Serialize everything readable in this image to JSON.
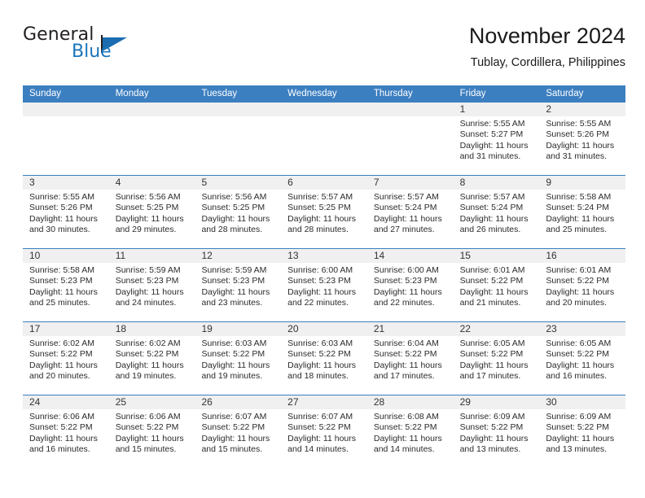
{
  "brand": {
    "name_top": "General",
    "name_bottom": "Blue",
    "flag_icon": "triangle-flag-icon",
    "accent_color": "#1b75bb"
  },
  "header": {
    "title": "November 2024",
    "location": "Tublay, Cordillera, Philippines"
  },
  "calendar": {
    "header_color": "#3c7fc0",
    "daynum_band_color": "#f0f0f0",
    "weekdays": [
      "Sunday",
      "Monday",
      "Tuesday",
      "Wednesday",
      "Thursday",
      "Friday",
      "Saturday"
    ],
    "weeks": [
      [
        {
          "day": "",
          "empty": true
        },
        {
          "day": "",
          "empty": true
        },
        {
          "day": "",
          "empty": true
        },
        {
          "day": "",
          "empty": true
        },
        {
          "day": "",
          "empty": true
        },
        {
          "day": "1",
          "sunrise": "Sunrise: 5:55 AM",
          "sunset": "Sunset: 5:27 PM",
          "daylight1": "Daylight: 11 hours",
          "daylight2": "and 31 minutes."
        },
        {
          "day": "2",
          "sunrise": "Sunrise: 5:55 AM",
          "sunset": "Sunset: 5:26 PM",
          "daylight1": "Daylight: 11 hours",
          "daylight2": "and 31 minutes."
        }
      ],
      [
        {
          "day": "3",
          "sunrise": "Sunrise: 5:55 AM",
          "sunset": "Sunset: 5:26 PM",
          "daylight1": "Daylight: 11 hours",
          "daylight2": "and 30 minutes."
        },
        {
          "day": "4",
          "sunrise": "Sunrise: 5:56 AM",
          "sunset": "Sunset: 5:25 PM",
          "daylight1": "Daylight: 11 hours",
          "daylight2": "and 29 minutes."
        },
        {
          "day": "5",
          "sunrise": "Sunrise: 5:56 AM",
          "sunset": "Sunset: 5:25 PM",
          "daylight1": "Daylight: 11 hours",
          "daylight2": "and 28 minutes."
        },
        {
          "day": "6",
          "sunrise": "Sunrise: 5:57 AM",
          "sunset": "Sunset: 5:25 PM",
          "daylight1": "Daylight: 11 hours",
          "daylight2": "and 28 minutes."
        },
        {
          "day": "7",
          "sunrise": "Sunrise: 5:57 AM",
          "sunset": "Sunset: 5:24 PM",
          "daylight1": "Daylight: 11 hours",
          "daylight2": "and 27 minutes."
        },
        {
          "day": "8",
          "sunrise": "Sunrise: 5:57 AM",
          "sunset": "Sunset: 5:24 PM",
          "daylight1": "Daylight: 11 hours",
          "daylight2": "and 26 minutes."
        },
        {
          "day": "9",
          "sunrise": "Sunrise: 5:58 AM",
          "sunset": "Sunset: 5:24 PM",
          "daylight1": "Daylight: 11 hours",
          "daylight2": "and 25 minutes."
        }
      ],
      [
        {
          "day": "10",
          "sunrise": "Sunrise: 5:58 AM",
          "sunset": "Sunset: 5:23 PM",
          "daylight1": "Daylight: 11 hours",
          "daylight2": "and 25 minutes."
        },
        {
          "day": "11",
          "sunrise": "Sunrise: 5:59 AM",
          "sunset": "Sunset: 5:23 PM",
          "daylight1": "Daylight: 11 hours",
          "daylight2": "and 24 minutes."
        },
        {
          "day": "12",
          "sunrise": "Sunrise: 5:59 AM",
          "sunset": "Sunset: 5:23 PM",
          "daylight1": "Daylight: 11 hours",
          "daylight2": "and 23 minutes."
        },
        {
          "day": "13",
          "sunrise": "Sunrise: 6:00 AM",
          "sunset": "Sunset: 5:23 PM",
          "daylight1": "Daylight: 11 hours",
          "daylight2": "and 22 minutes."
        },
        {
          "day": "14",
          "sunrise": "Sunrise: 6:00 AM",
          "sunset": "Sunset: 5:23 PM",
          "daylight1": "Daylight: 11 hours",
          "daylight2": "and 22 minutes."
        },
        {
          "day": "15",
          "sunrise": "Sunrise: 6:01 AM",
          "sunset": "Sunset: 5:22 PM",
          "daylight1": "Daylight: 11 hours",
          "daylight2": "and 21 minutes."
        },
        {
          "day": "16",
          "sunrise": "Sunrise: 6:01 AM",
          "sunset": "Sunset: 5:22 PM",
          "daylight1": "Daylight: 11 hours",
          "daylight2": "and 20 minutes."
        }
      ],
      [
        {
          "day": "17",
          "sunrise": "Sunrise: 6:02 AM",
          "sunset": "Sunset: 5:22 PM",
          "daylight1": "Daylight: 11 hours",
          "daylight2": "and 20 minutes."
        },
        {
          "day": "18",
          "sunrise": "Sunrise: 6:02 AM",
          "sunset": "Sunset: 5:22 PM",
          "daylight1": "Daylight: 11 hours",
          "daylight2": "and 19 minutes."
        },
        {
          "day": "19",
          "sunrise": "Sunrise: 6:03 AM",
          "sunset": "Sunset: 5:22 PM",
          "daylight1": "Daylight: 11 hours",
          "daylight2": "and 19 minutes."
        },
        {
          "day": "20",
          "sunrise": "Sunrise: 6:03 AM",
          "sunset": "Sunset: 5:22 PM",
          "daylight1": "Daylight: 11 hours",
          "daylight2": "and 18 minutes."
        },
        {
          "day": "21",
          "sunrise": "Sunrise: 6:04 AM",
          "sunset": "Sunset: 5:22 PM",
          "daylight1": "Daylight: 11 hours",
          "daylight2": "and 17 minutes."
        },
        {
          "day": "22",
          "sunrise": "Sunrise: 6:05 AM",
          "sunset": "Sunset: 5:22 PM",
          "daylight1": "Daylight: 11 hours",
          "daylight2": "and 17 minutes."
        },
        {
          "day": "23",
          "sunrise": "Sunrise: 6:05 AM",
          "sunset": "Sunset: 5:22 PM",
          "daylight1": "Daylight: 11 hours",
          "daylight2": "and 16 minutes."
        }
      ],
      [
        {
          "day": "24",
          "sunrise": "Sunrise: 6:06 AM",
          "sunset": "Sunset: 5:22 PM",
          "daylight1": "Daylight: 11 hours",
          "daylight2": "and 16 minutes."
        },
        {
          "day": "25",
          "sunrise": "Sunrise: 6:06 AM",
          "sunset": "Sunset: 5:22 PM",
          "daylight1": "Daylight: 11 hours",
          "daylight2": "and 15 minutes."
        },
        {
          "day": "26",
          "sunrise": "Sunrise: 6:07 AM",
          "sunset": "Sunset: 5:22 PM",
          "daylight1": "Daylight: 11 hours",
          "daylight2": "and 15 minutes."
        },
        {
          "day": "27",
          "sunrise": "Sunrise: 6:07 AM",
          "sunset": "Sunset: 5:22 PM",
          "daylight1": "Daylight: 11 hours",
          "daylight2": "and 14 minutes."
        },
        {
          "day": "28",
          "sunrise": "Sunrise: 6:08 AM",
          "sunset": "Sunset: 5:22 PM",
          "daylight1": "Daylight: 11 hours",
          "daylight2": "and 14 minutes."
        },
        {
          "day": "29",
          "sunrise": "Sunrise: 6:09 AM",
          "sunset": "Sunset: 5:22 PM",
          "daylight1": "Daylight: 11 hours",
          "daylight2": "and 13 minutes."
        },
        {
          "day": "30",
          "sunrise": "Sunrise: 6:09 AM",
          "sunset": "Sunset: 5:22 PM",
          "daylight1": "Daylight: 11 hours",
          "daylight2": "and 13 minutes."
        }
      ]
    ]
  }
}
